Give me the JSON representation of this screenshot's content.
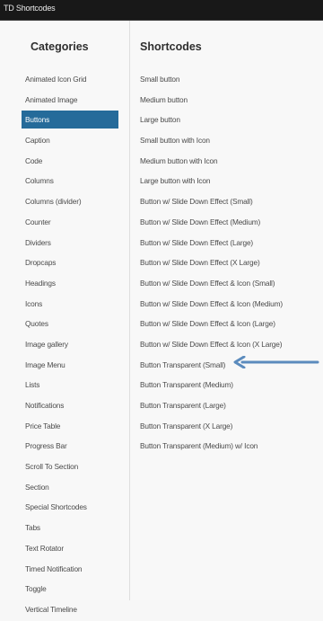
{
  "window": {
    "title": "TD Shortcodes"
  },
  "categories": {
    "heading": "Categories",
    "items": [
      {
        "label": "Animated Icon Grid"
      },
      {
        "label": "Animated Image"
      },
      {
        "label": "Buttons",
        "selected": true
      },
      {
        "label": "Caption"
      },
      {
        "label": "Code"
      },
      {
        "label": "Columns"
      },
      {
        "label": "Columns (divider)"
      },
      {
        "label": "Counter"
      },
      {
        "label": "Dividers"
      },
      {
        "label": "Dropcaps"
      },
      {
        "label": "Headings"
      },
      {
        "label": "Icons"
      },
      {
        "label": "Quotes"
      },
      {
        "label": "Image gallery"
      },
      {
        "label": "Image Menu"
      },
      {
        "label": "Lists"
      },
      {
        "label": "Notifications"
      },
      {
        "label": "Price Table"
      },
      {
        "label": "Progress Bar"
      },
      {
        "label": "Scroll To Section"
      },
      {
        "label": "Section"
      },
      {
        "label": "Special Shortcodes"
      },
      {
        "label": "Tabs"
      },
      {
        "label": "Text Rotator"
      },
      {
        "label": "Timed Notification"
      },
      {
        "label": "Toggle"
      },
      {
        "label": "Vertical Timeline"
      }
    ]
  },
  "shortcodes": {
    "heading": "Shortcodes",
    "items": [
      {
        "label": "Small button"
      },
      {
        "label": "Medium button"
      },
      {
        "label": "Large button"
      },
      {
        "label": "Small button with Icon"
      },
      {
        "label": "Medium button with Icon"
      },
      {
        "label": "Large button with Icon"
      },
      {
        "label": "Button w/ Slide Down Effect (Small)"
      },
      {
        "label": "Button w/ Slide Down Effect (Medium)"
      },
      {
        "label": "Button w/ Slide Down Effect (Large)"
      },
      {
        "label": "Button w/ Slide Down Effect (X Large)"
      },
      {
        "label": "Button w/ Slide Down Effect & Icon (Small)"
      },
      {
        "label": "Button w/ Slide Down Effect & Icon (Medium)"
      },
      {
        "label": "Button w/ Slide Down Effect & Icon (Large)"
      },
      {
        "label": "Button w/ Slide Down Effect & Icon (X Large)"
      },
      {
        "label": "Button Transparent (Small)"
      },
      {
        "label": "Button Transparent (Medium)"
      },
      {
        "label": "Button Transparent (Large)"
      },
      {
        "label": "Button Transparent (X Large)"
      },
      {
        "label": "Button Transparent (Medium) w/ Icon"
      }
    ]
  },
  "annotation": {
    "icon": "arrow-left-icon",
    "color": "#5b8bbd"
  },
  "colors": {
    "accent": "#256b9a",
    "titlebar": "#181818"
  }
}
